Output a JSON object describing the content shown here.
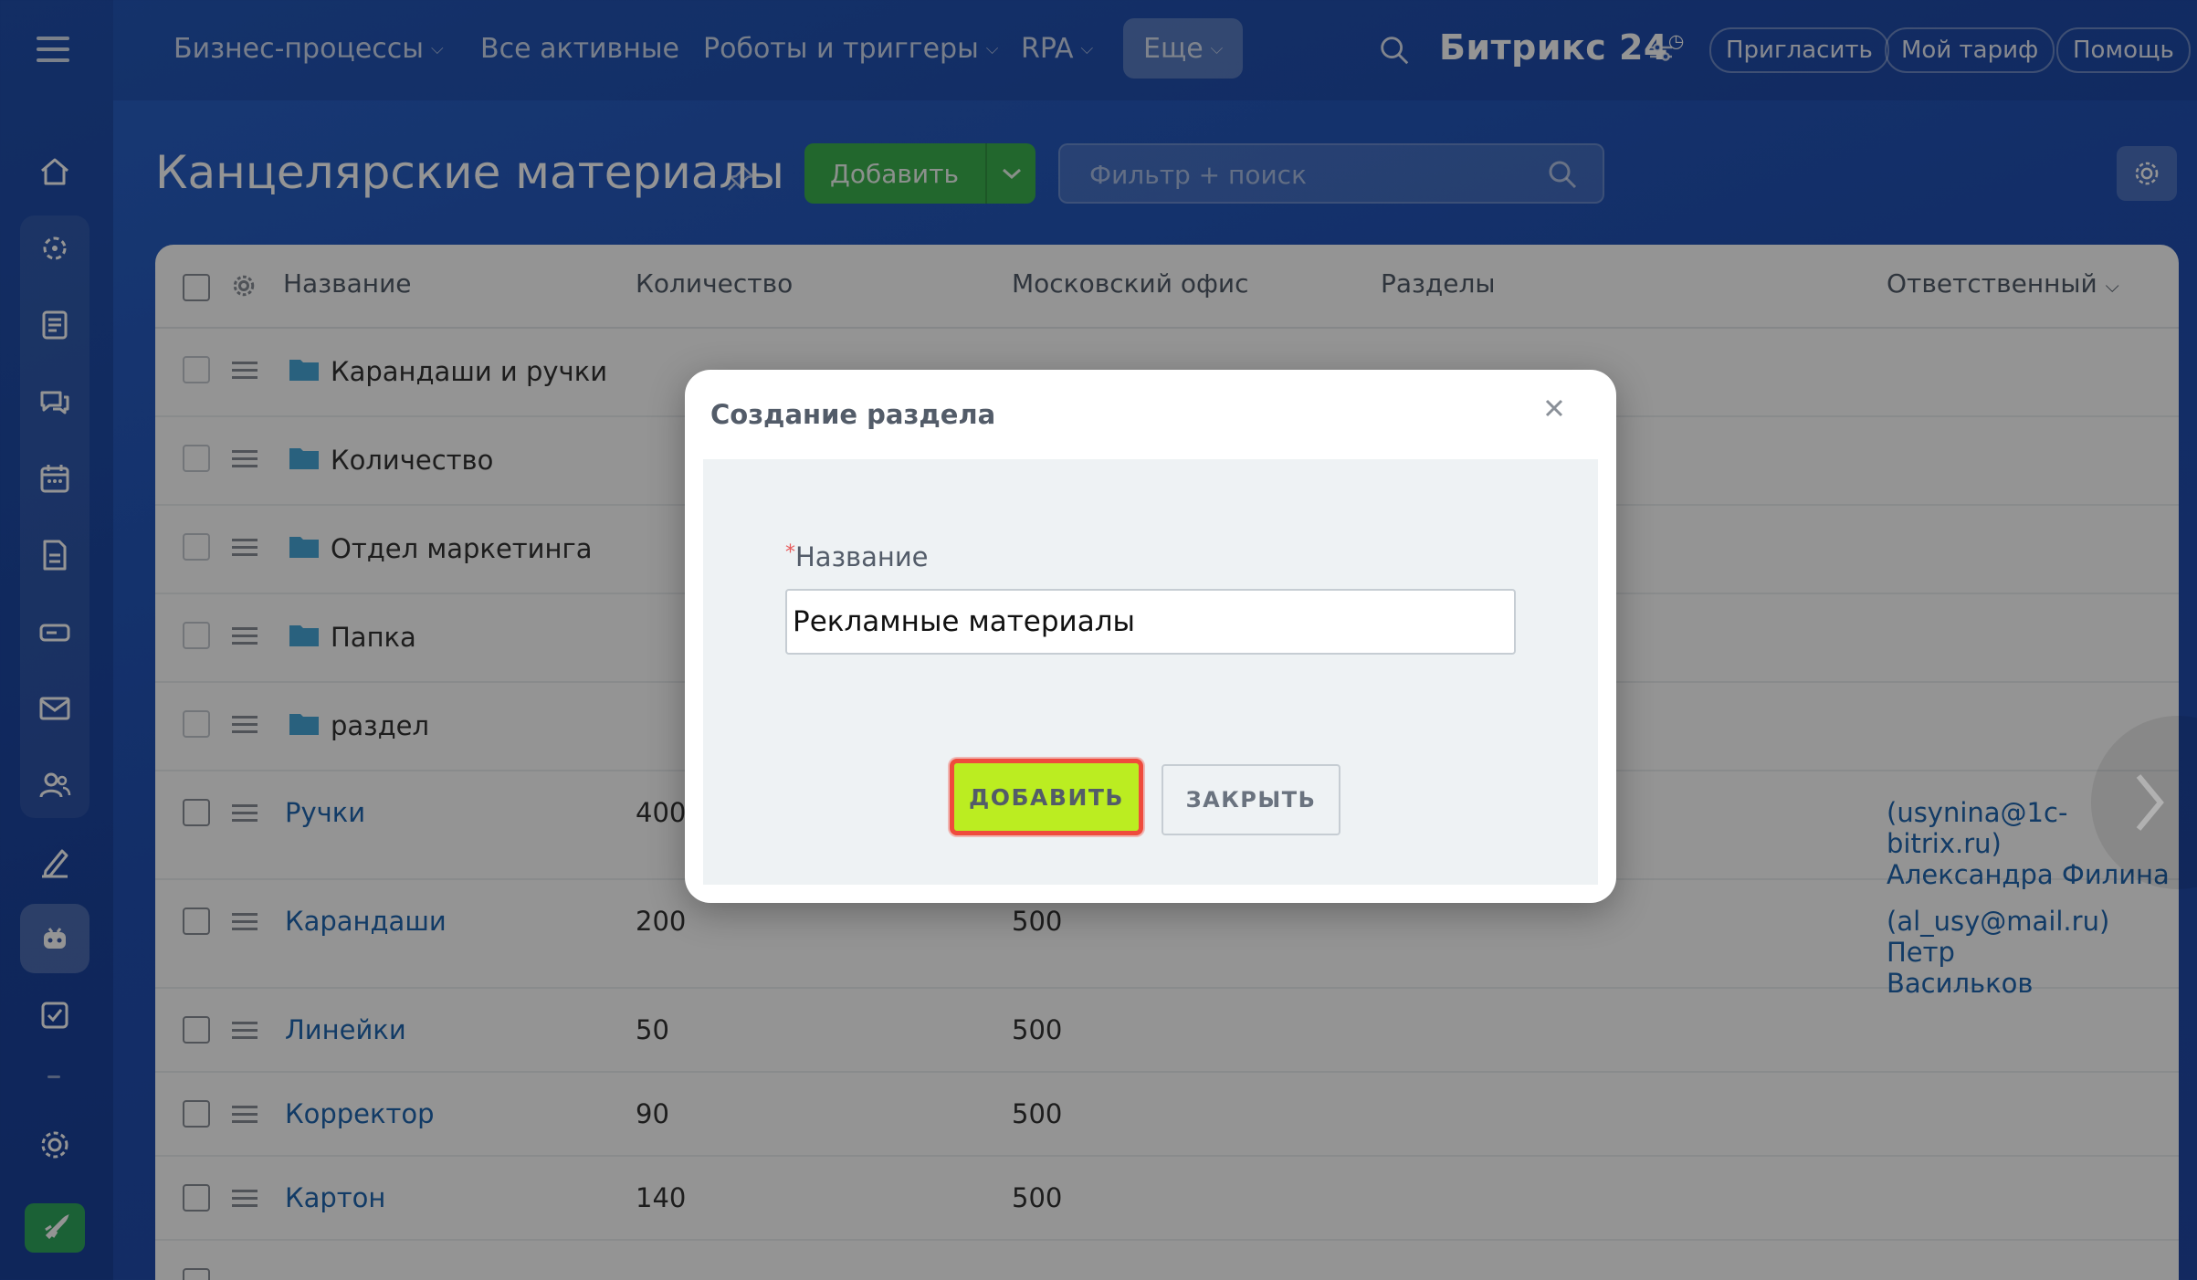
{
  "topnav": {
    "items": [
      {
        "label": "Бизнес-процессы",
        "has_menu": true
      },
      {
        "label": "Все активные",
        "has_menu": false
      },
      {
        "label": "Роботы и триггеры",
        "has_menu": true
      },
      {
        "label": "RPA",
        "has_menu": true
      },
      {
        "label": "Еще",
        "has_menu": true
      }
    ],
    "brand": "Битрикс 24",
    "invite": "Пригласить",
    "tariff": "Мой тариф",
    "help": "Помощь"
  },
  "header": {
    "title": "Канцелярские материалы",
    "add_label": "Добавить",
    "filter_placeholder": "Фильтр + поиск"
  },
  "grid": {
    "columns": [
      "Название",
      "Количество",
      "Московский офис",
      "Разделы",
      "Ответственный"
    ],
    "sections": [
      "Карандаши и ручки",
      "Количество",
      "Отдел маркетинга",
      "Папка",
      "раздел"
    ],
    "items": [
      {
        "name": "Ручки",
        "qty": "400",
        "moscow": "",
        "owner_line1": "(usynina@1c-bitrix.ru)",
        "owner_line2": "Александра Филина"
      },
      {
        "name": "Карандаши",
        "qty": "200",
        "moscow": "500",
        "owner_line1": "(al_usy@mail.ru) Петр",
        "owner_line2": "Васильков"
      },
      {
        "name": "Линейки",
        "qty": "50",
        "moscow": "500",
        "owner_line1": "",
        "owner_line2": ""
      },
      {
        "name": "Корректор",
        "qty": "90",
        "moscow": "500",
        "owner_line1": "",
        "owner_line2": ""
      },
      {
        "name": "Картон",
        "qty": "140",
        "moscow": "500",
        "owner_line1": "",
        "owner_line2": ""
      }
    ]
  },
  "modal": {
    "title": "Создание раздела",
    "required_mark": "*",
    "field_label": "Название",
    "field_value": "Рекламные материалы",
    "submit": "ДОБАВИТЬ",
    "close": "ЗАКРЫТЬ"
  },
  "colors": {
    "accent_green": "#3bb24e",
    "highlight_button": "#bbed21",
    "highlight_border": "#ef4b3c",
    "link": "#2067b0"
  }
}
